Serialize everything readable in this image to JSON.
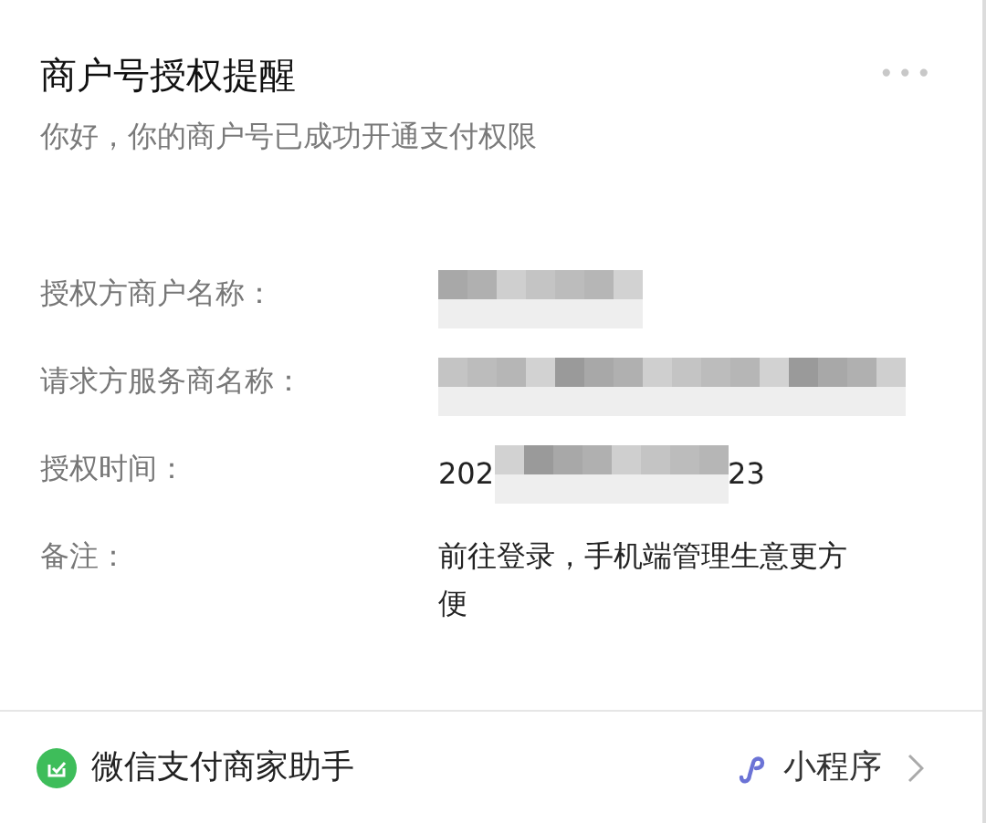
{
  "card": {
    "title": "商户号授权提醒",
    "more_button": "•••",
    "subtitle": "你好，你的商户号已成功开通支付权限",
    "fields": [
      {
        "label": "授权方商户名称：",
        "value": [
          {
            "kind": "redacted"
          }
        ]
      },
      {
        "label": "请求方服务商名称：",
        "value": [
          {
            "kind": "redacted"
          }
        ]
      },
      {
        "label": "授权时间：",
        "value": [
          {
            "kind": "text",
            "text": "202"
          },
          {
            "kind": "redacted"
          },
          {
            "kind": "text",
            "text": "23"
          }
        ]
      },
      {
        "label": "备注：",
        "value": [
          {
            "kind": "text",
            "text": "前往登录，手机端管理生意更方便"
          }
        ]
      }
    ],
    "footer": {
      "source": "微信支付商家助手",
      "app_type": "小程序"
    }
  }
}
